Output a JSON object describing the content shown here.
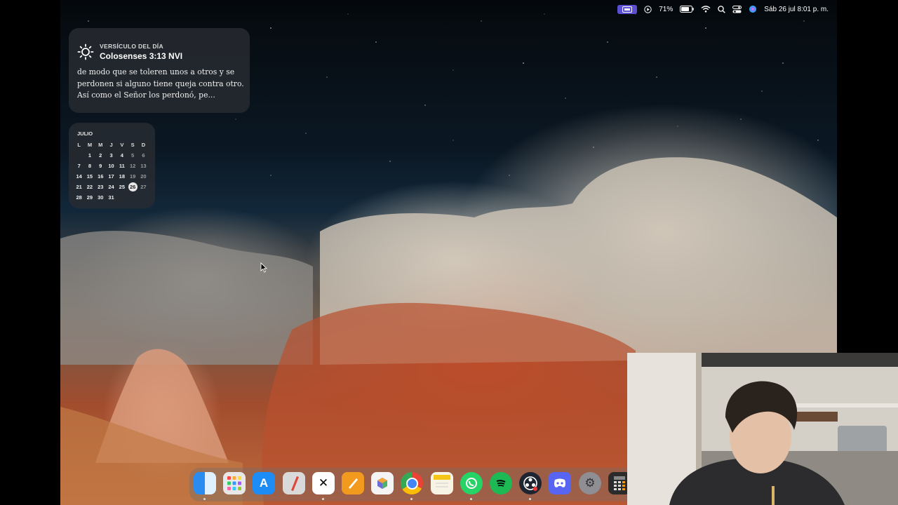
{
  "menubar": {
    "battery": "71%",
    "datetime": "Sáb 26 jul  8:01 p. m."
  },
  "verse_widget": {
    "kicker": "VERSÍCULO DEL DÍA",
    "reference": "Colosenses 3:13 NVI",
    "text": "de modo que se toleren unos a otros y se perdonen si alguno tiene queja contra otro. Así como el Señor los perdonó, pe..."
  },
  "calendar_widget": {
    "month": "JULIO",
    "weekdays": [
      "L",
      "M",
      "M",
      "J",
      "V",
      "S",
      "D"
    ],
    "today": "26",
    "rows": [
      [
        "",
        "1",
        "2",
        "3",
        "4",
        "5",
        "6"
      ],
      [
        "7",
        "8",
        "9",
        "10",
        "11",
        "12",
        "13"
      ],
      [
        "14",
        "15",
        "16",
        "17",
        "18",
        "19",
        "20"
      ],
      [
        "21",
        "22",
        "23",
        "24",
        "25",
        "26",
        "27"
      ],
      [
        "28",
        "29",
        "30",
        "31",
        "",
        "",
        ""
      ]
    ]
  },
  "dock": {
    "apps": [
      {
        "name": "finder-icon",
        "glyph": "",
        "color": "#2a8cf0"
      },
      {
        "name": "launchpad-icon",
        "glyph": "",
        "color": "#e8e8e8"
      },
      {
        "name": "app-store-icon",
        "glyph": "A",
        "color": "#1e8cf5"
      },
      {
        "name": "pencil-app-icon",
        "glyph": "",
        "color": "#d9d9d9"
      },
      {
        "name": "capcut-icon",
        "glyph": "✕",
        "color": "#ffffff"
      },
      {
        "name": "pages-icon",
        "glyph": "",
        "color": "#f29a1d"
      },
      {
        "name": "cube-app-icon",
        "glyph": "⬡",
        "color": "#f4f4f4"
      },
      {
        "name": "chrome-icon",
        "glyph": "",
        "color": "#ffffff"
      },
      {
        "name": "notes-icon",
        "glyph": "",
        "color": "#f7f4e6"
      },
      {
        "name": "whatsapp-icon",
        "glyph": "",
        "color": "#25d366"
      },
      {
        "name": "spotify-icon",
        "glyph": "",
        "color": "#1db954"
      },
      {
        "name": "obs-icon",
        "glyph": "",
        "color": "#1f2530"
      },
      {
        "name": "discord-icon",
        "glyph": "",
        "color": "#5865f2"
      },
      {
        "name": "system-settings-icon",
        "glyph": "⚙",
        "color": "#8e8e93"
      },
      {
        "name": "calculator-icon",
        "glyph": "",
        "color": "#2b2b2b"
      }
    ]
  }
}
